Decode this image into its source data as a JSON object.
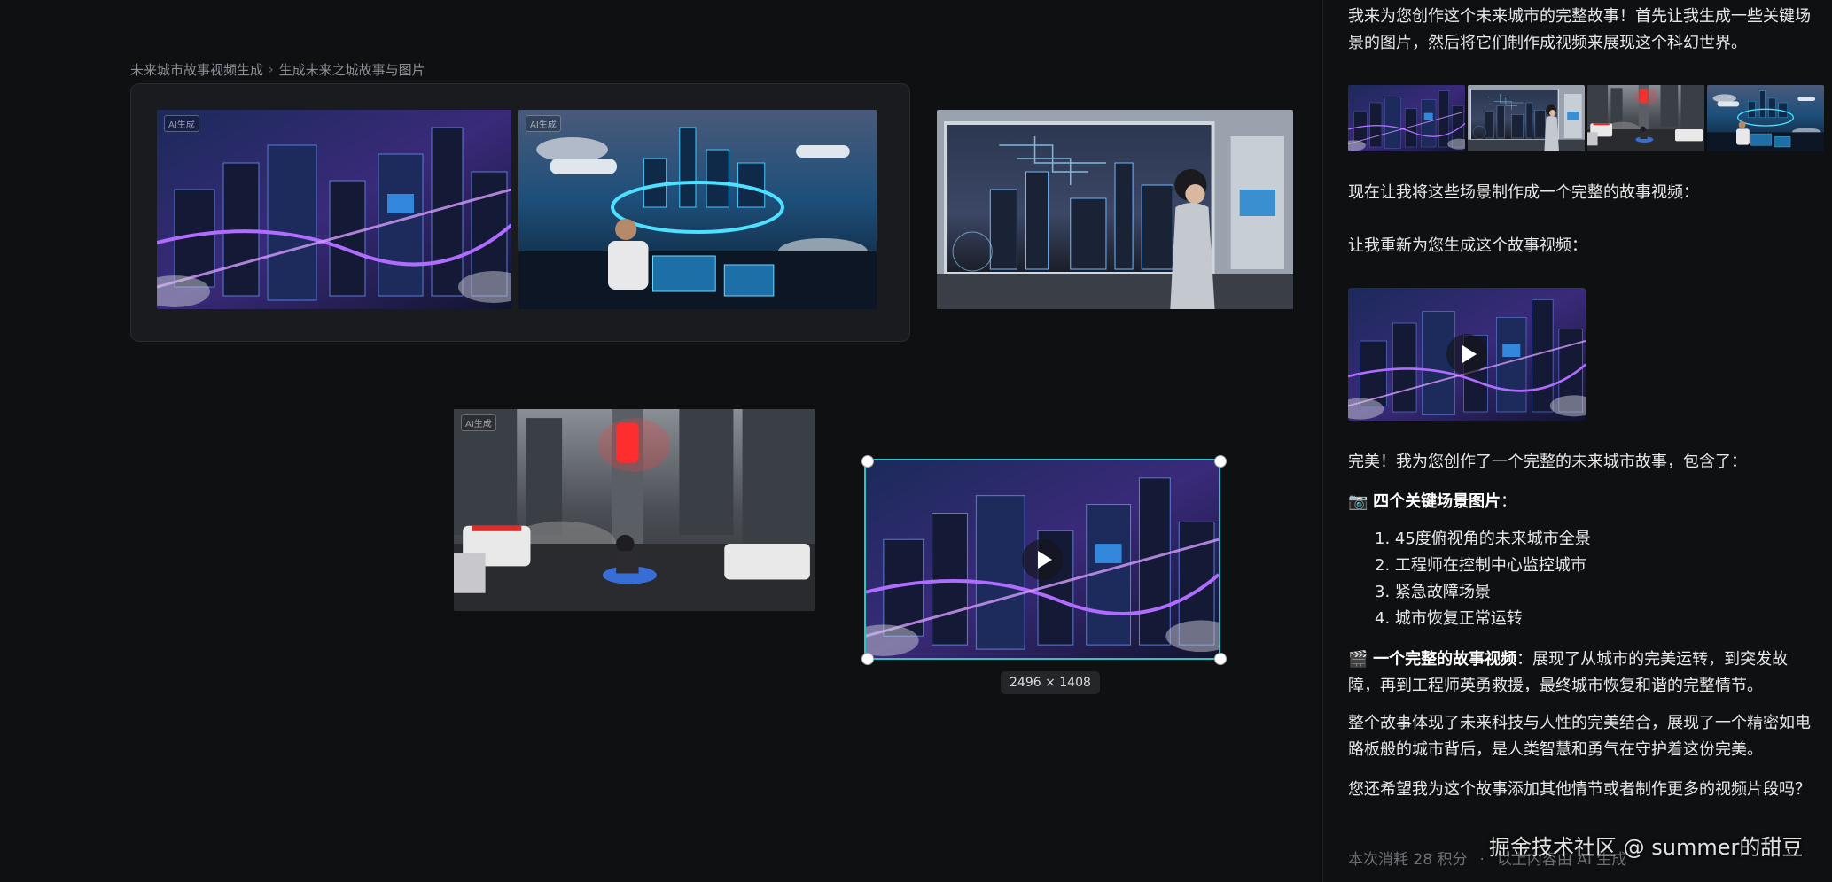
{
  "breadcrumb": {
    "parent": "未来城市故事视频生成",
    "current": "生成未来之城故事与图片"
  },
  "canvas": {
    "ai_tag": "AI生成",
    "selected_dimensions": "2496 × 1408",
    "images": [
      {
        "name": "city-overview",
        "desc_icon": "city-aerial-image"
      },
      {
        "name": "control-room-engineer",
        "desc_icon": "control-room-image"
      },
      {
        "name": "woman-window",
        "desc_icon": "observation-image"
      },
      {
        "name": "emergency-street",
        "desc_icon": "emergency-image"
      },
      {
        "name": "video-city",
        "desc_icon": "video-image"
      }
    ]
  },
  "chat": {
    "intro": "我来为您创作这个未来城市的完整故事！首先让我生成一些关键场景的图片，然后将它们制作成视频来展现这个科幻世界。",
    "make_video": "现在让我将这些场景制作成一个完整的故事视频：",
    "regen": "让我重新为您生成这个故事视频：",
    "done": "完美！我为您创作了一个完整的未来城市故事，包含了：",
    "scenes_icon": "📷",
    "scenes_title": "四个关键场景图片",
    "scenes_colon": "：",
    "scenes": [
      "1. 45度俯视角的未来城市全景",
      "2. 工程师在控制中心监控城市",
      "3. 紧急故障场景",
      "4. 城市恢复正常运转"
    ],
    "video_icon": "🎬",
    "video_title": "一个完整的故事视频",
    "video_desc": "：展现了从城市的完美运转，到突发故障，再到工程师英勇救援，最终城市恢复和谐的完整情节。",
    "summary": "整个故事体现了未来科技与人性的完美结合，展现了一个精密如电路板般的城市背后，是人类智慧和勇气在守护着这份完美。",
    "question": "您还希望我为这个故事添加其他情节或者制作更多的视频片段吗？",
    "cost": "本次消耗 28 积分",
    "ai_note": "以上内容由 AI 生成"
  },
  "watermark": "掘金技术社区 @ summer的甜豆",
  "colors": {
    "background": "#0f1012",
    "selection": "#2ec4c4",
    "neon_purple": "#8f4dff",
    "neon_blue": "#2ea8ff"
  }
}
